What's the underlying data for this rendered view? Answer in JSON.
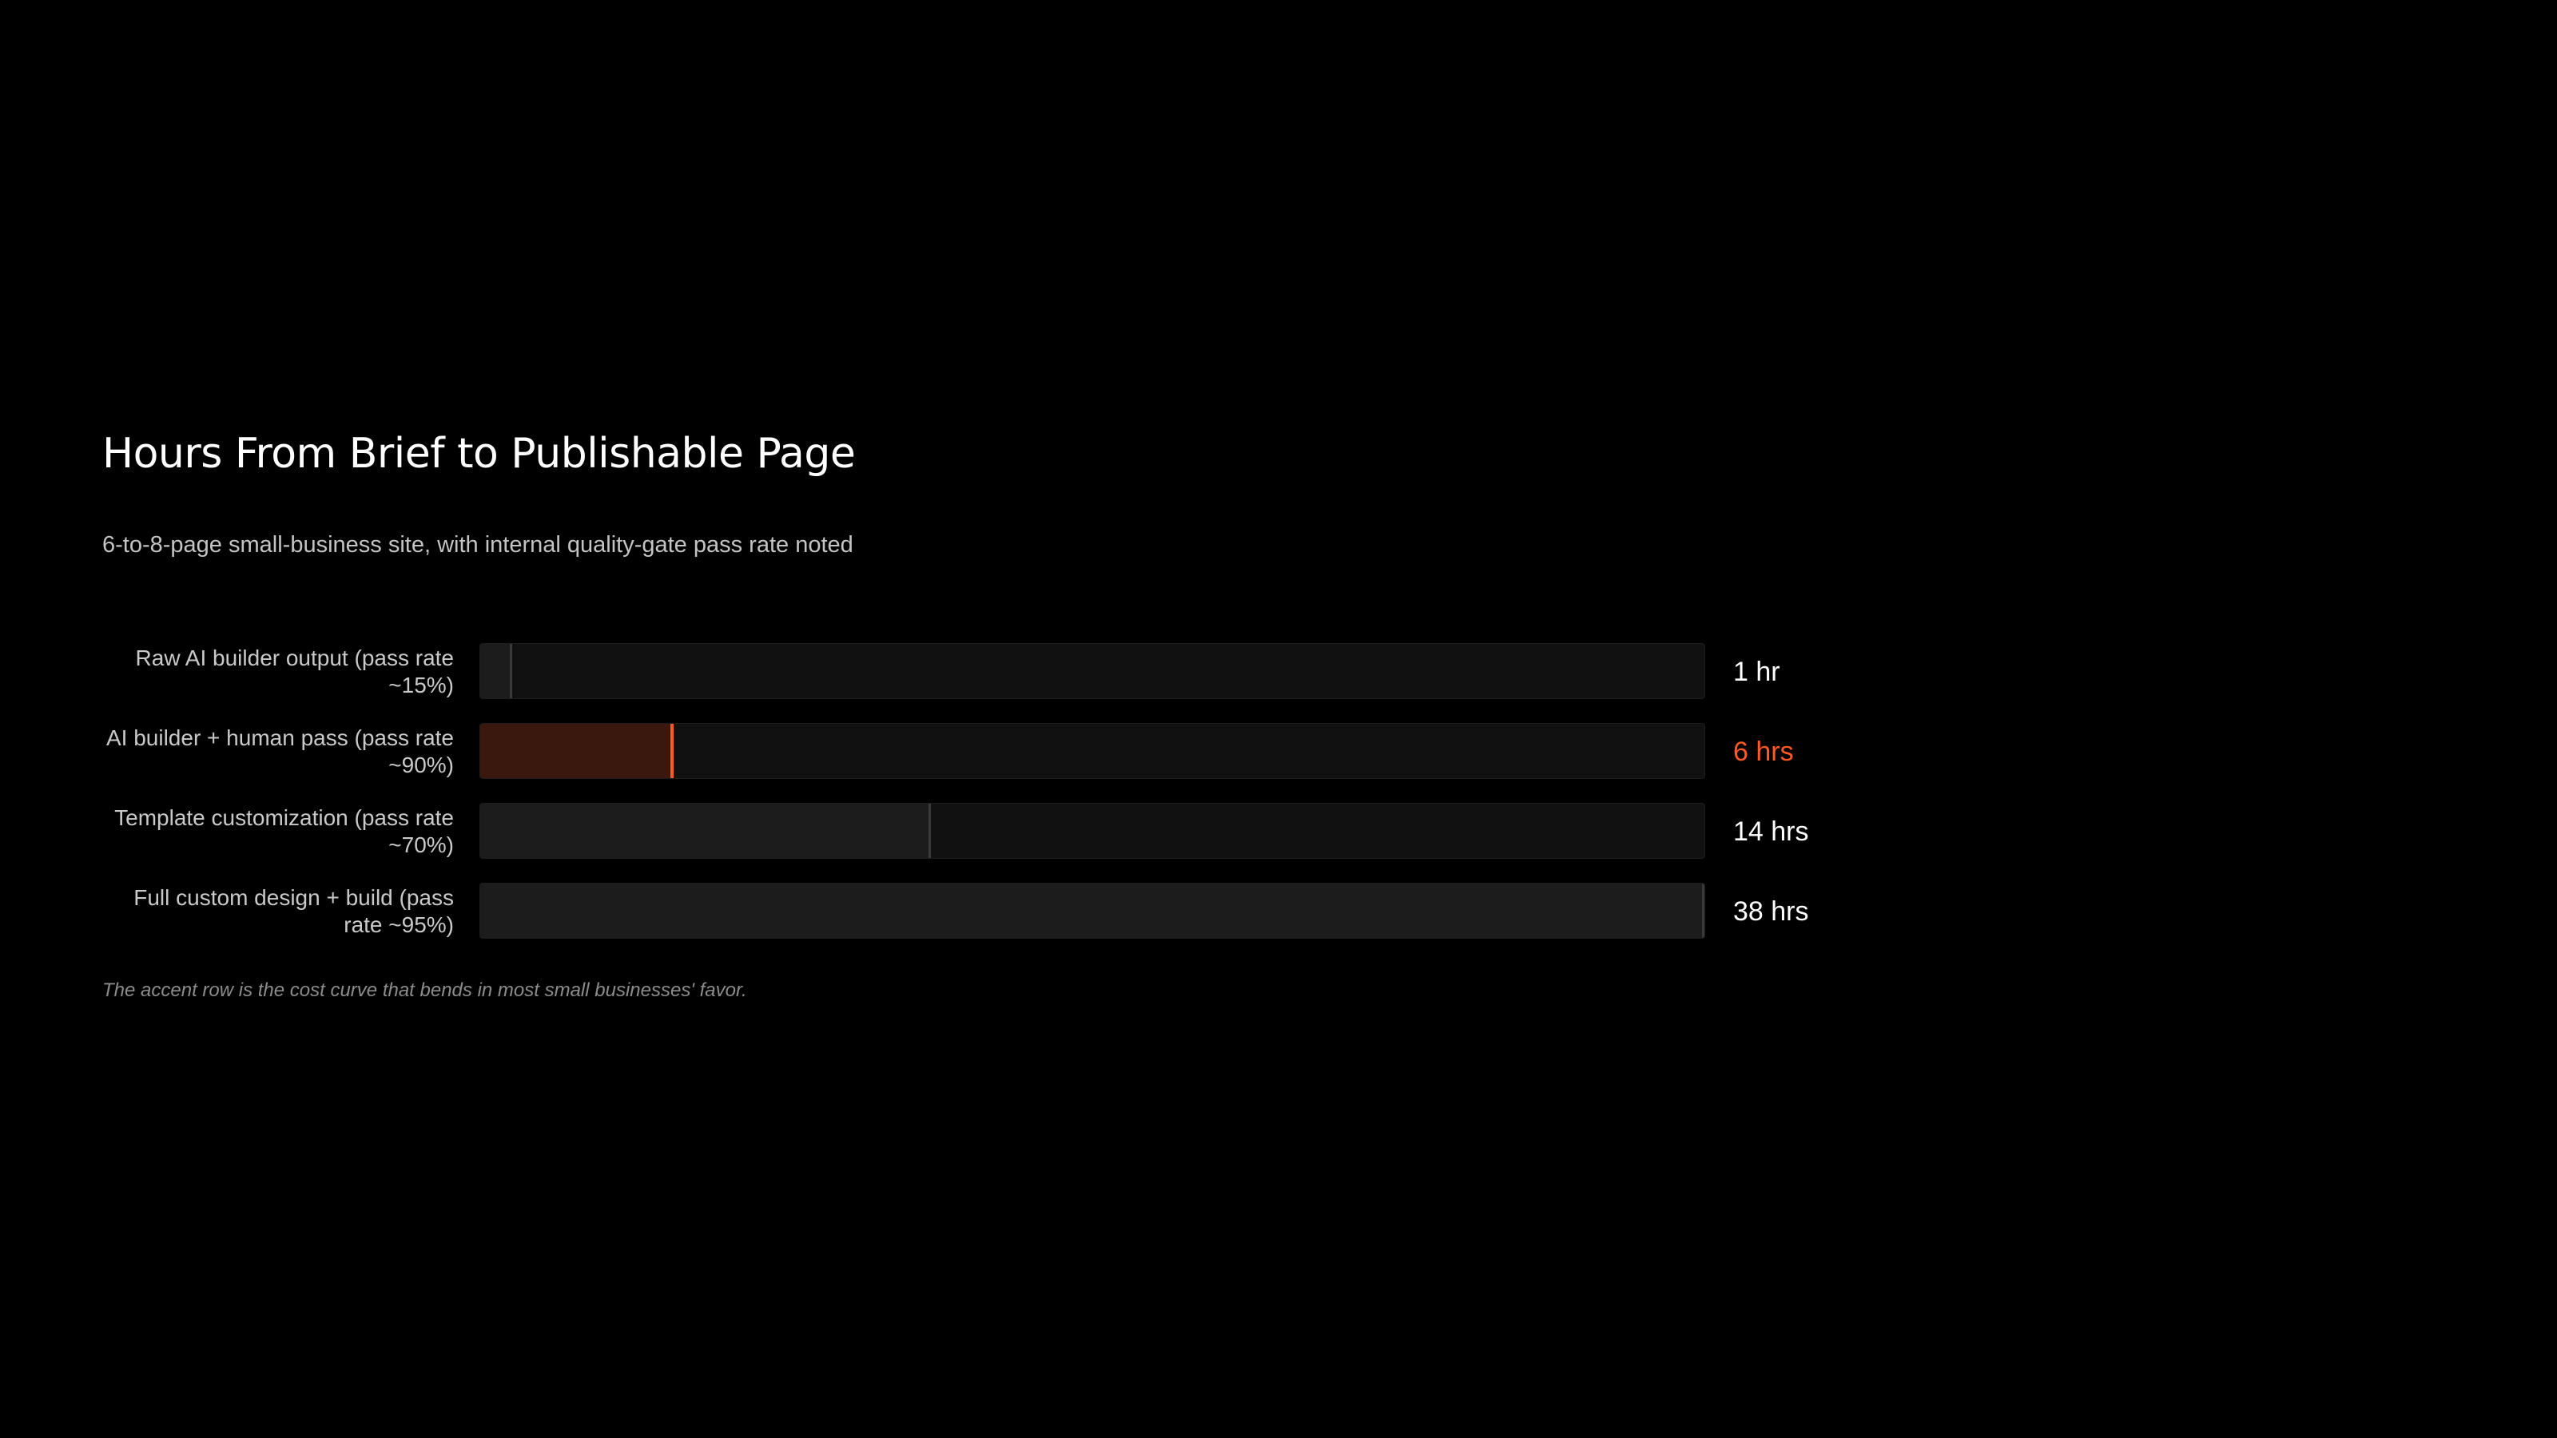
{
  "chart_data": {
    "type": "bar",
    "orientation": "horizontal",
    "title": "Hours From Brief to Publishable Page",
    "subtitle": "6-to-8-page small-business site, with internal quality-gate pass rate noted",
    "categories": [
      "Raw AI builder output (pass rate ~15%)",
      "AI builder + human pass (pass rate ~90%)",
      "Template customization (pass rate ~70%)",
      "Full custom design + build (pass rate ~95%)"
    ],
    "values": [
      1,
      6,
      14,
      38
    ],
    "value_labels": [
      "1 hr",
      "6 hrs",
      "14 hrs",
      "38 hrs"
    ],
    "highlight_index": 1,
    "xlim": [
      0,
      38
    ],
    "grid": false,
    "legend": "none",
    "note": "The accent row is the cost curve that bends in most small businesses' favor."
  },
  "colors": {
    "background": "#000000",
    "accent": "#ff5a24",
    "accent_fill": "#3a180d",
    "bar_fill": "#1c1c1c",
    "track": "#111111"
  }
}
